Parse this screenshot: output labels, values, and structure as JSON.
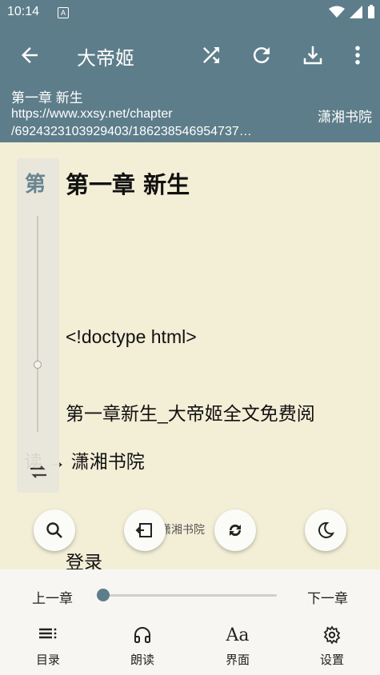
{
  "status": {
    "time": "10:14",
    "app_indicator": "A"
  },
  "toolbar": {
    "title": "大帝姬",
    "icons": [
      "arrow-left-icon",
      "shuffle-icon",
      "refresh-icon",
      "download-icon",
      "more-vert-icon"
    ]
  },
  "subbar": {
    "chapter": "第一章 新生",
    "url_line1": "https://www.xxsy.net/chapter",
    "url_line2": "/6924323103929403/186238546954737…",
    "source": "潇湘书院"
  },
  "content": {
    "chapter_title": "第一章 新生",
    "paragraphs": [
      "<!doctype html>",
      "第一章新生_大帝姬全文免费阅",
      "读 → 潇湘书院",
      "登录"
    ],
    "faded_text": "潇湘书院"
  },
  "sidepanel": {
    "top_label": "第",
    "read_label": "读"
  },
  "fabs": [
    "search-icon",
    "exit-icon",
    "sync-icon",
    "moon-icon"
  ],
  "bottom": {
    "prev": "上一章",
    "next": "下一章",
    "progress": 0.0,
    "nav": [
      {
        "label": "目录",
        "icon": "list-icon"
      },
      {
        "label": "朗读",
        "icon": "headphones-icon"
      },
      {
        "label": "界面",
        "icon": "font-icon"
      },
      {
        "label": "设置",
        "icon": "gear-icon"
      }
    ]
  },
  "colors": {
    "toolbar": "#5e7d8a",
    "page_bg": "#f3eed6",
    "accent": "#5e7d8a"
  }
}
